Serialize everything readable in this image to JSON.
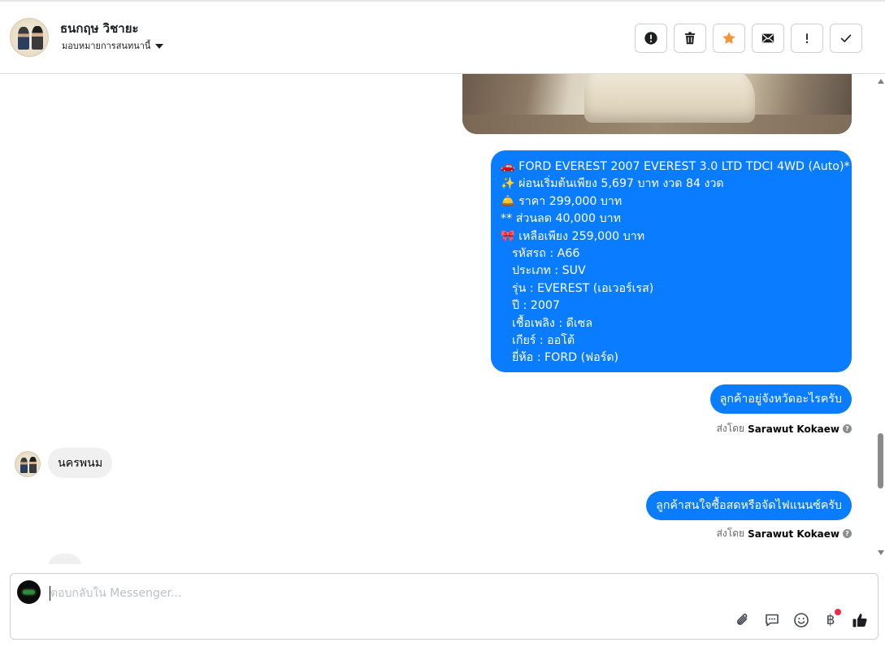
{
  "header": {
    "contact_name": "ธนกฤษ วิชายะ",
    "assignment_label": "มอบหมายการสนทนานี้"
  },
  "messages": {
    "car_listing": {
      "lines": [
        "🚗 FORD EVEREST 2007 EVEREST 3.0 LTD TDCI 4WD (Auto)*",
        "✨ ผ่อนเริ่มต้นเพียง 5,697 บาท งวด 84 งวด",
        "🛎️ ราคา 299,000 บาท",
        "** ส่วนลด 40,000 บาท",
        "🎀 เหลือเพียง 259,000 บาท"
      ],
      "detail_lines": [
        "รหัสรถ : A66",
        "ประเภท : SUV",
        "รุ่น : EVEREST (เอเวอร์เรส)",
        "ปี : 2007",
        "เชื้อเพลิง : ดีเซล",
        "เกียร์ : ออโต้",
        "ยี่ห้อ : FORD (ฟอร์ด)"
      ]
    },
    "out_1": "ลูกค้าอยู่จังหวัดอะไรครับ",
    "in_1": "นครพนม",
    "out_2": "ลูกค้าสนใจซื้อสดหรือจัดไฟแนนซ์ครับ",
    "sent_by_prefix": "ส่งโดย",
    "sent_by_name": "Sarawut Kokaew",
    "info_mark": "?"
  },
  "composer": {
    "placeholder": "ตอบกลับใน Messenger..."
  },
  "icons": {
    "header_actions": [
      "alert-circle-icon",
      "trash-icon",
      "star-icon",
      "envelope-icon",
      "exclamation-icon",
      "checkmark-icon"
    ],
    "composer_tools": [
      "paperclip-icon",
      "saved-reply-icon",
      "emoji-icon",
      "baht-payment-icon",
      "thumbs-up-icon"
    ],
    "baht_glyph": "฿"
  },
  "colors": {
    "accent_blue": "#0a7cff",
    "star_orange": "#f7923b",
    "incoming_bubble": "#f0f0f0",
    "notification_red": "#f02849"
  }
}
